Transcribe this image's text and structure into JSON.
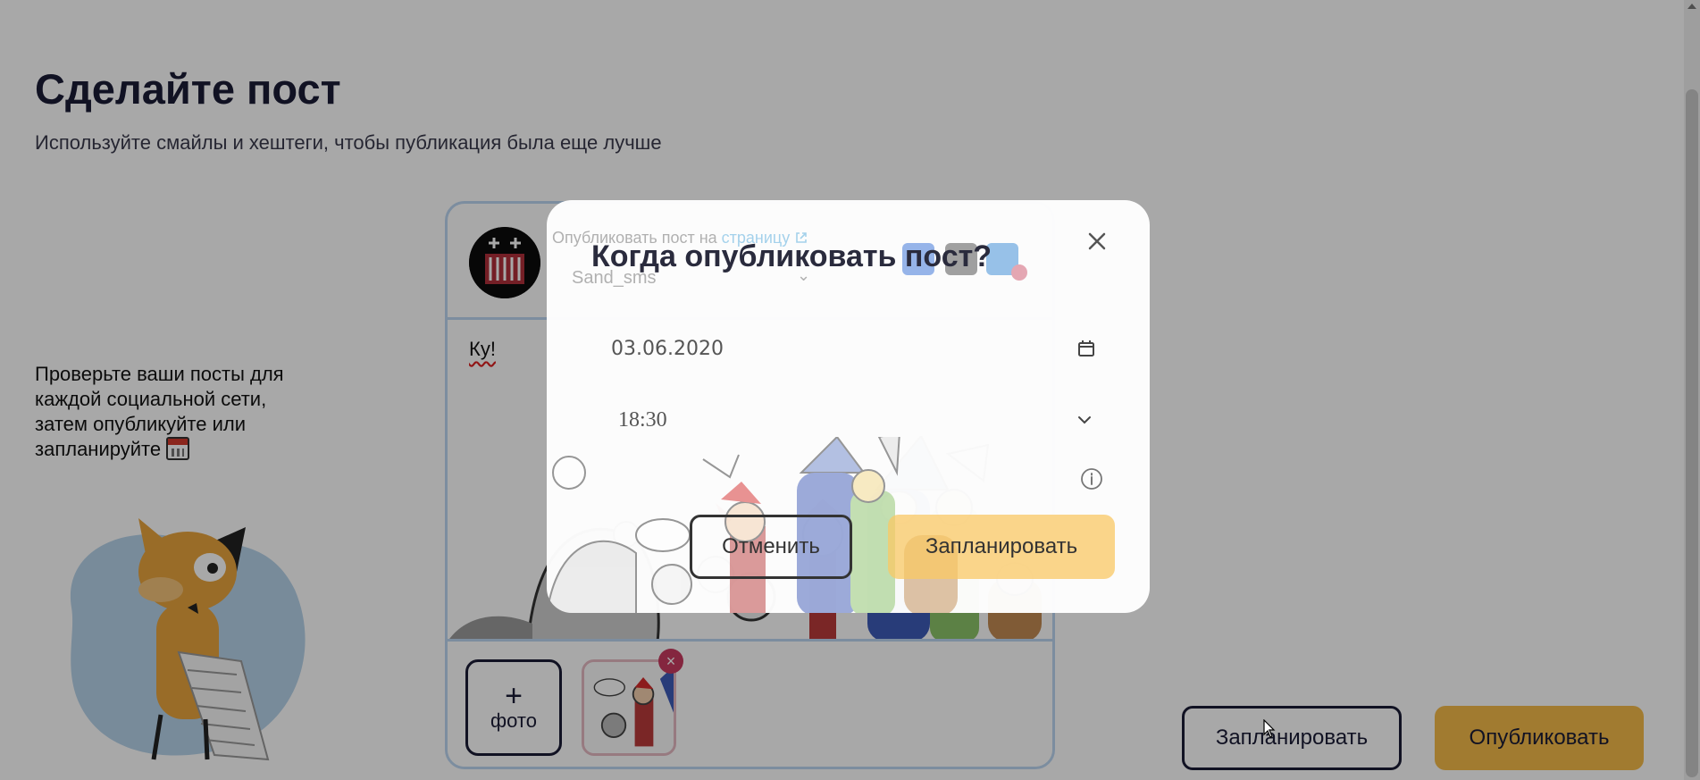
{
  "page": {
    "title": "Сделайте пост",
    "subtitle": "Используйте смайлы и хештеги, чтобы публикация была еще лучше",
    "side_text": "Проверьте ваши посты для каждой социальной сети, затем опубликуйте или запланируйте"
  },
  "post_card": {
    "text": "Ку!",
    "add_photo_plus": "+",
    "add_photo_label": "фото",
    "remove_thumb": "×"
  },
  "actions": {
    "schedule_label": "Запланировать",
    "publish_label": "Опубликовать"
  },
  "modal": {
    "title": "Когда опубликовать пост?",
    "ghost_publish_prefix": "Опубликовать пост на ",
    "ghost_publish_link": "страницу",
    "ghost_account": "Sand_sms",
    "date_value": "03.06.2020",
    "time_value": "18:30",
    "cancel_label": "Отменить",
    "confirm_label": "Запланировать"
  },
  "colors": {
    "accent": "#f5bb4a",
    "dark": "#1b1c36",
    "card_border": "#bcd6f2",
    "link": "#3b9ed8",
    "remove": "#c83a60"
  }
}
